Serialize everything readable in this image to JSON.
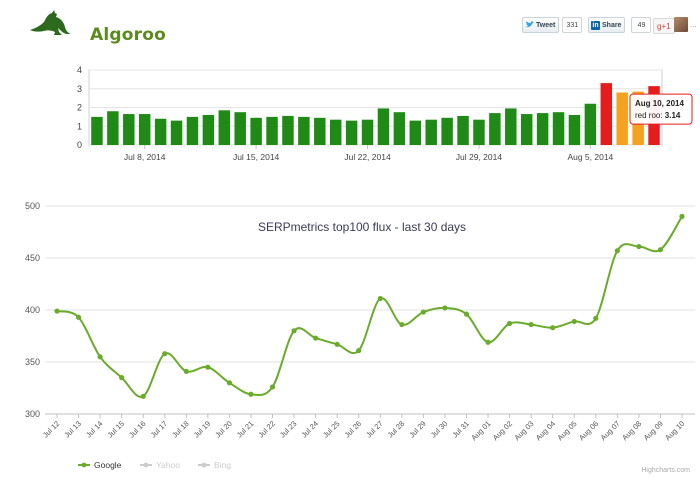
{
  "brand": {
    "name": "Algoroo"
  },
  "share": {
    "tweet_label": "Tweet",
    "tweet_count": "331",
    "linkedin_label": "Share",
    "linkedin_count": "49",
    "gplus_label": "g+1",
    "avatar_tail": "..."
  },
  "chart_data": [
    {
      "type": "bar",
      "ylim": [
        0,
        4
      ],
      "yticks": [
        "0",
        "1",
        "2",
        "3",
        "4"
      ],
      "x_tick_labels": [
        {
          "label": "Jul 8, 2014",
          "index": 3
        },
        {
          "label": "Jul 15, 2014",
          "index": 10
        },
        {
          "label": "Jul 22, 2014",
          "index": 17
        },
        {
          "label": "Jul 29, 2014",
          "index": 24
        },
        {
          "label": "Aug 5, 2014",
          "index": 31
        }
      ],
      "values": [
        1.5,
        1.8,
        1.65,
        1.65,
        1.4,
        1.3,
        1.5,
        1.6,
        1.85,
        1.75,
        1.45,
        1.5,
        1.55,
        1.5,
        1.45,
        1.35,
        1.3,
        1.35,
        1.95,
        1.75,
        1.3,
        1.35,
        1.45,
        1.55,
        1.35,
        1.7,
        1.95,
        1.65,
        1.7,
        1.75,
        1.6,
        2.2,
        3.3,
        2.8,
        2.85,
        3.14
      ],
      "bar_colors": [
        "#1f8a16",
        "#1f8a16",
        "#1f8a16",
        "#1f8a16",
        "#1f8a16",
        "#1f8a16",
        "#1f8a16",
        "#1f8a16",
        "#1f8a16",
        "#1f8a16",
        "#1f8a16",
        "#1f8a16",
        "#1f8a16",
        "#1f8a16",
        "#1f8a16",
        "#1f8a16",
        "#1f8a16",
        "#1f8a16",
        "#1f8a16",
        "#1f8a16",
        "#1f8a16",
        "#1f8a16",
        "#1f8a16",
        "#1f8a16",
        "#1f8a16",
        "#1f8a16",
        "#1f8a16",
        "#1f8a16",
        "#1f8a16",
        "#1f8a16",
        "#1f8a16",
        "#1f8a16",
        "#e51d1d",
        "#f4a21f",
        "#f4a21f",
        "#e51d1d"
      ],
      "grid": true,
      "tooltip": {
        "date": "Aug 10, 2014",
        "label": "red roo:",
        "value": "3.14",
        "bar_index": 35
      }
    },
    {
      "type": "line",
      "title": "SERPmetrics top100 flux - last 30 days",
      "ylim": [
        300,
        500
      ],
      "yticks": [
        "300",
        "350",
        "400",
        "450",
        "500"
      ],
      "categories": [
        "Jul 12",
        "Jul 13",
        "Jul 14",
        "Jul 15",
        "Jul 16",
        "Jul 17",
        "Jul 18",
        "Jul 19",
        "Jul 20",
        "Jul 21",
        "Jul 22",
        "Jul 23",
        "Jul 24",
        "Jul 25",
        "Jul 26",
        "Jul 27",
        "Jul 28",
        "Jul 29",
        "Jul 30",
        "Jul 31",
        "Aug 01",
        "Aug 02",
        "Aug 03",
        "Aug 04",
        "Aug 05",
        "Aug 06",
        "Aug 07",
        "Aug 08",
        "Aug 09",
        "Aug 10"
      ],
      "series": [
        {
          "name": "Google",
          "color": "#6aab2c",
          "visible": true,
          "values": [
            399,
            393,
            355,
            335,
            317,
            358,
            341,
            345,
            330,
            319,
            326,
            380,
            373,
            367,
            361,
            411,
            386,
            398,
            402,
            396,
            369,
            387,
            386,
            383,
            389,
            392,
            457,
            461,
            458,
            490
          ]
        },
        {
          "name": "Yahoo",
          "color": "#cccccc",
          "visible": false,
          "values": []
        },
        {
          "name": "Bing",
          "color": "#cccccc",
          "visible": false,
          "values": []
        }
      ],
      "legend_position": "bottom-left",
      "grid": true,
      "watermark": "Highcharts.com"
    }
  ]
}
